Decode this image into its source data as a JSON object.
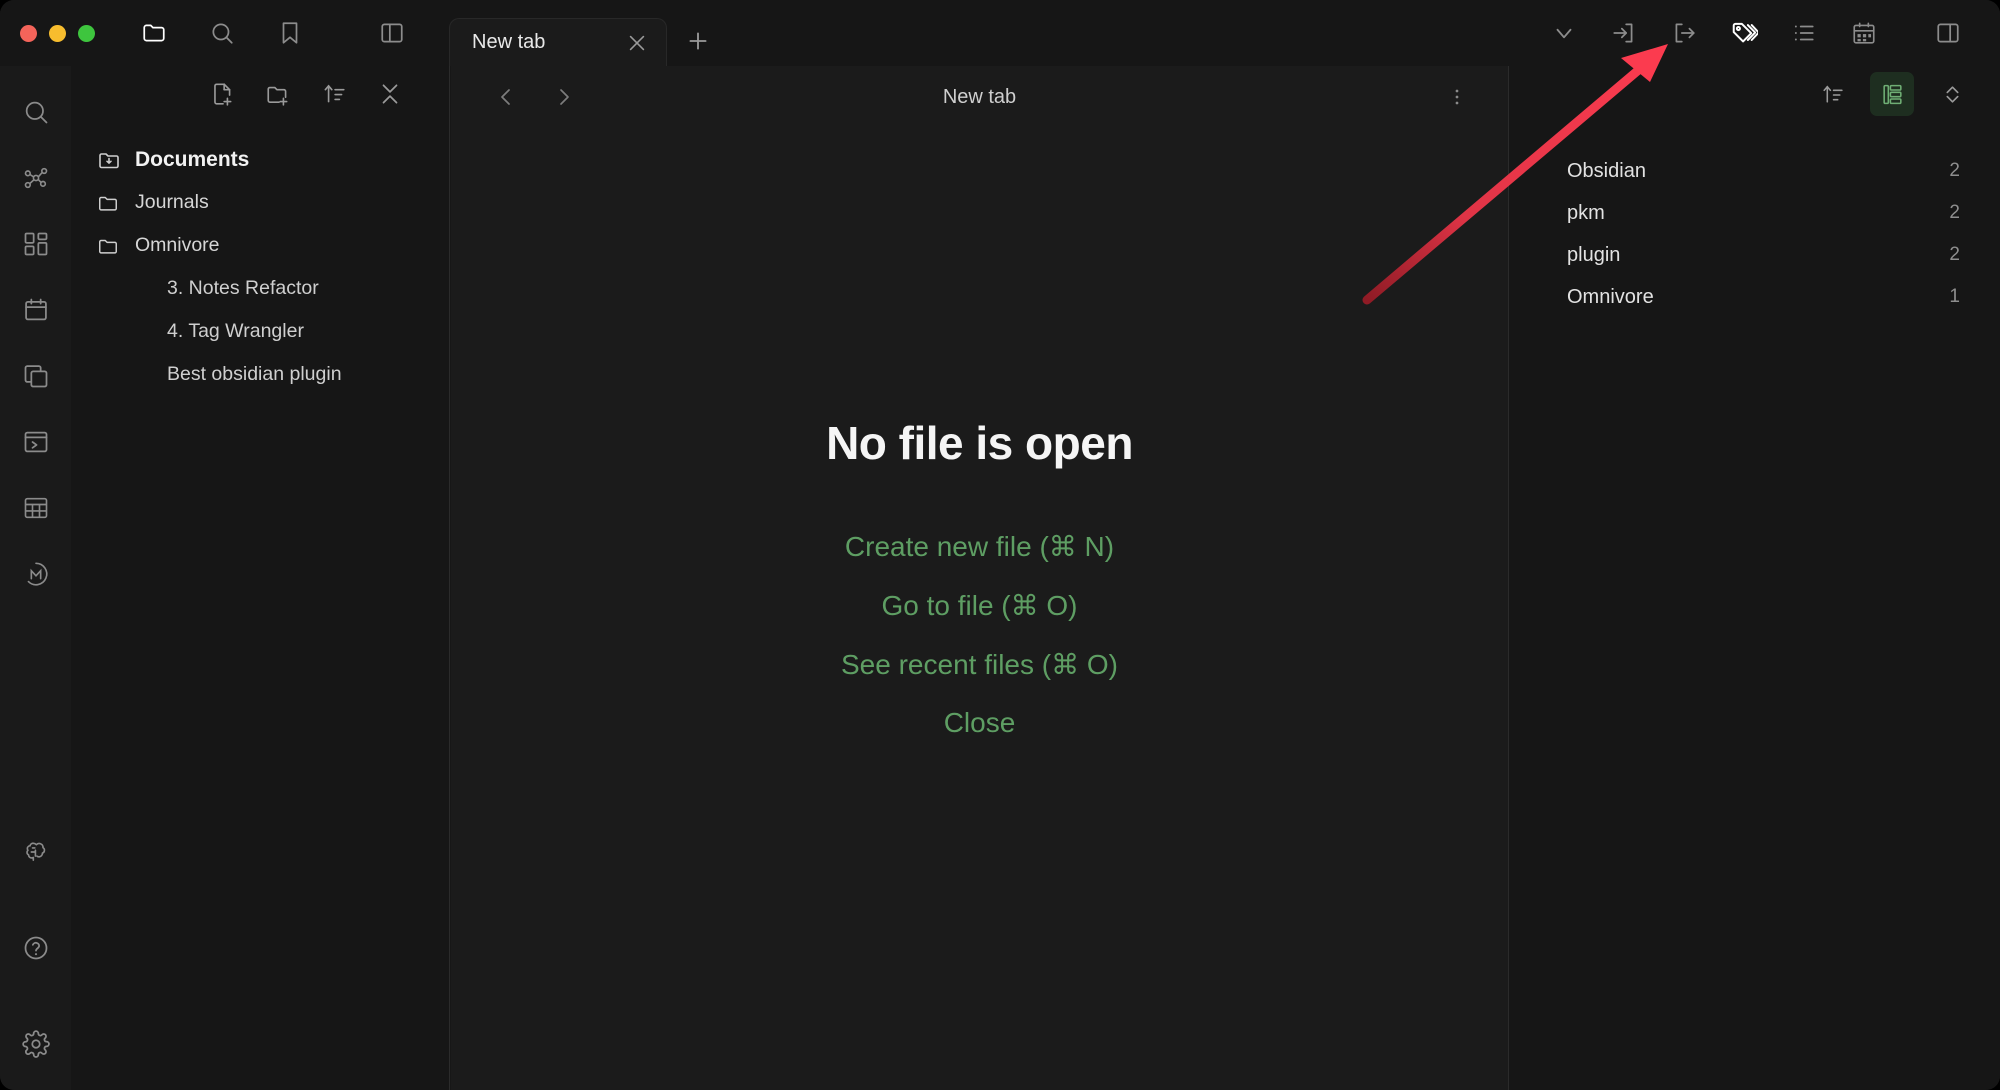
{
  "window": {
    "app": "Obsidian",
    "traffic_lights": [
      {
        "name": "close",
        "color": "#f4645a"
      },
      {
        "name": "minimize",
        "color": "#f7bd2e"
      },
      {
        "name": "maximize",
        "color": "#3ec53e"
      }
    ]
  },
  "titlebar": {
    "left_icons": [
      {
        "name": "folder-icon",
        "label": "Files"
      },
      {
        "name": "search-icon",
        "label": "Search"
      },
      {
        "name": "bookmark-icon",
        "label": "Bookmarks"
      },
      {
        "name": "left-sidebar-toggle-icon",
        "label": "Toggle left sidebar"
      }
    ],
    "right_icons": [
      {
        "name": "chevron-down-icon",
        "label": "Tab list"
      },
      {
        "name": "arrow-into-bracket-icon",
        "label": "Import"
      },
      {
        "name": "arrow-out-of-bracket-icon",
        "label": "Export"
      },
      {
        "name": "tags-icon",
        "label": "Tags",
        "active": true
      },
      {
        "name": "outline-list-icon",
        "label": "Outline"
      },
      {
        "name": "calendar-icon",
        "label": "Calendar"
      },
      {
        "name": "right-sidebar-toggle-icon",
        "label": "Toggle right sidebar"
      }
    ],
    "tabs": [
      {
        "label": "New tab",
        "active": true,
        "close_glyph": "×"
      }
    ],
    "new_tab_glyph": "+"
  },
  "ribbon": {
    "top_items": [
      {
        "name": "search-icon",
        "label": "Search"
      },
      {
        "name": "graph-view-icon",
        "label": "Graph view"
      },
      {
        "name": "canvas-grid-icon",
        "label": "Canvas"
      },
      {
        "name": "calendar-icon",
        "label": "Calendar"
      },
      {
        "name": "layers-copy-icon",
        "label": "Workspaces"
      },
      {
        "name": "console-window-icon",
        "label": "Terminal"
      },
      {
        "name": "table-icon",
        "label": "Table"
      },
      {
        "name": "m-circle-logo-icon",
        "label": "Make.md"
      }
    ],
    "bottom_items": [
      {
        "name": "brain-icon",
        "label": "Smart connections"
      },
      {
        "name": "help-circle-icon",
        "label": "Help"
      },
      {
        "name": "settings-gear-icon",
        "label": "Settings"
      }
    ]
  },
  "file_explorer": {
    "toolbar": [
      {
        "name": "new-note-icon",
        "label": "New note"
      },
      {
        "name": "new-folder-icon",
        "label": "New folder"
      },
      {
        "name": "sort-icon",
        "label": "Change sort order"
      },
      {
        "name": "collapse-all-icon",
        "label": "Collapse all"
      }
    ],
    "tree": [
      {
        "label": "Documents",
        "type": "vault",
        "icon": "vault-folder-icon",
        "indent": 0
      },
      {
        "label": "Journals",
        "type": "folder",
        "icon": "folder-icon",
        "indent": 0
      },
      {
        "label": "Omnivore",
        "type": "folder",
        "icon": "folder-icon",
        "indent": 0
      },
      {
        "label": "3. Notes Refactor",
        "type": "file",
        "icon": "",
        "indent": 1
      },
      {
        "label": "4. Tag Wrangler",
        "type": "file",
        "icon": "",
        "indent": 1
      },
      {
        "label": "Best obsidian plugin",
        "type": "file",
        "icon": "",
        "indent": 1
      }
    ]
  },
  "main": {
    "nav": [
      {
        "name": "back-icon",
        "label": "Navigate back"
      },
      {
        "name": "forward-icon",
        "label": "Navigate forward"
      }
    ],
    "view_title": "New tab",
    "more_options": {
      "name": "more-options-icon",
      "glyph": "⋮"
    },
    "empty_state": {
      "title": "No file is open",
      "actions": [
        "Create new file (⌘ N)",
        "Go to file (⌘ O)",
        "See recent files (⌘ O)",
        "Close"
      ],
      "link_color": "#5e9e63"
    }
  },
  "tags_panel": {
    "toolbar": [
      {
        "name": "sort-icon",
        "label": "Change sort order",
        "active": false
      },
      {
        "name": "nested-tags-icon",
        "label": "Nested tags view",
        "active": true
      },
      {
        "name": "expand-collapse-icon",
        "label": "Expand / collapse",
        "active": false
      }
    ],
    "tags": [
      {
        "name": "Obsidian",
        "count": "2"
      },
      {
        "name": "pkm",
        "count": "2"
      },
      {
        "name": "plugin",
        "count": "2"
      },
      {
        "name": "Omnivore",
        "count": "1"
      }
    ]
  },
  "annotation": {
    "type": "arrow",
    "color_start": "#8f1b25",
    "color_end": "#fb3b4f",
    "points_to": "tags-icon"
  },
  "theme": {
    "background": "#171717",
    "panel": "#161616",
    "main": "#1b1b1b",
    "ribbon": "#1a1a1a",
    "border": "#2b2b2b",
    "text": "#dcdcdc",
    "accent_green": "#5e9e63",
    "accent_green_bg": "#1e2e20"
  }
}
